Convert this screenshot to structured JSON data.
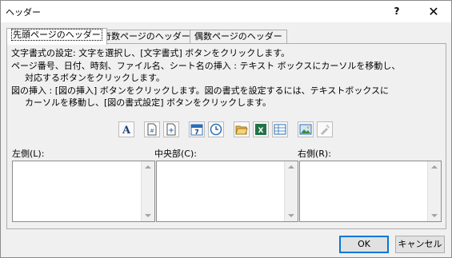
{
  "window": {
    "title": "ヘッダー",
    "help_label": "?",
    "close_label": "✕"
  },
  "tabs": [
    {
      "label": "先頭ページのヘッダー",
      "active": true
    },
    {
      "label": "奇数ページのヘッダー",
      "active": false
    },
    {
      "label": "偶数ページのヘッダー",
      "active": false
    }
  ],
  "instructions": [
    "文字書式の設定: 文字を選択し、[文字書式] ボタンをクリックします。",
    "ページ番号、日付、時刻、ファイル名、シート名の挿入 : テキスト ボックスにカーソルを移動し、",
    "対応するボタンをクリックします。",
    "図の挿入 : [図の挿入] ボタンをクリックします。図の書式を設定するには、テキストボックスに",
    "カーソルを移動し、[図の書式設定] ボタンをクリックします。"
  ],
  "toolbar": [
    {
      "icon": "format-text-icon",
      "label": "A"
    },
    {
      "icon": "insert-page-number-icon",
      "label": "#"
    },
    {
      "icon": "insert-page-count-icon",
      "label": "+"
    },
    {
      "icon": "insert-date-icon",
      "label": "7"
    },
    {
      "icon": "insert-time-icon",
      "label": ""
    },
    {
      "icon": "insert-file-path-icon",
      "label": ""
    },
    {
      "icon": "insert-file-name-icon",
      "label": "X"
    },
    {
      "icon": "insert-sheet-name-icon",
      "label": ""
    },
    {
      "icon": "insert-picture-icon",
      "label": ""
    },
    {
      "icon": "format-picture-icon",
      "label": ""
    }
  ],
  "sections": {
    "left": {
      "label": "左側(L):",
      "value": ""
    },
    "center": {
      "label": "中央部(C):",
      "value": ""
    },
    "right": {
      "label": "右側(R):",
      "value": ""
    }
  },
  "buttons": {
    "ok": "OK",
    "cancel": "キャンセル"
  },
  "colors": {
    "accent": "#0078d7",
    "excel_green": "#217346",
    "folder_yellow": "#e8b548",
    "blue_icon": "#2b6fb6"
  }
}
